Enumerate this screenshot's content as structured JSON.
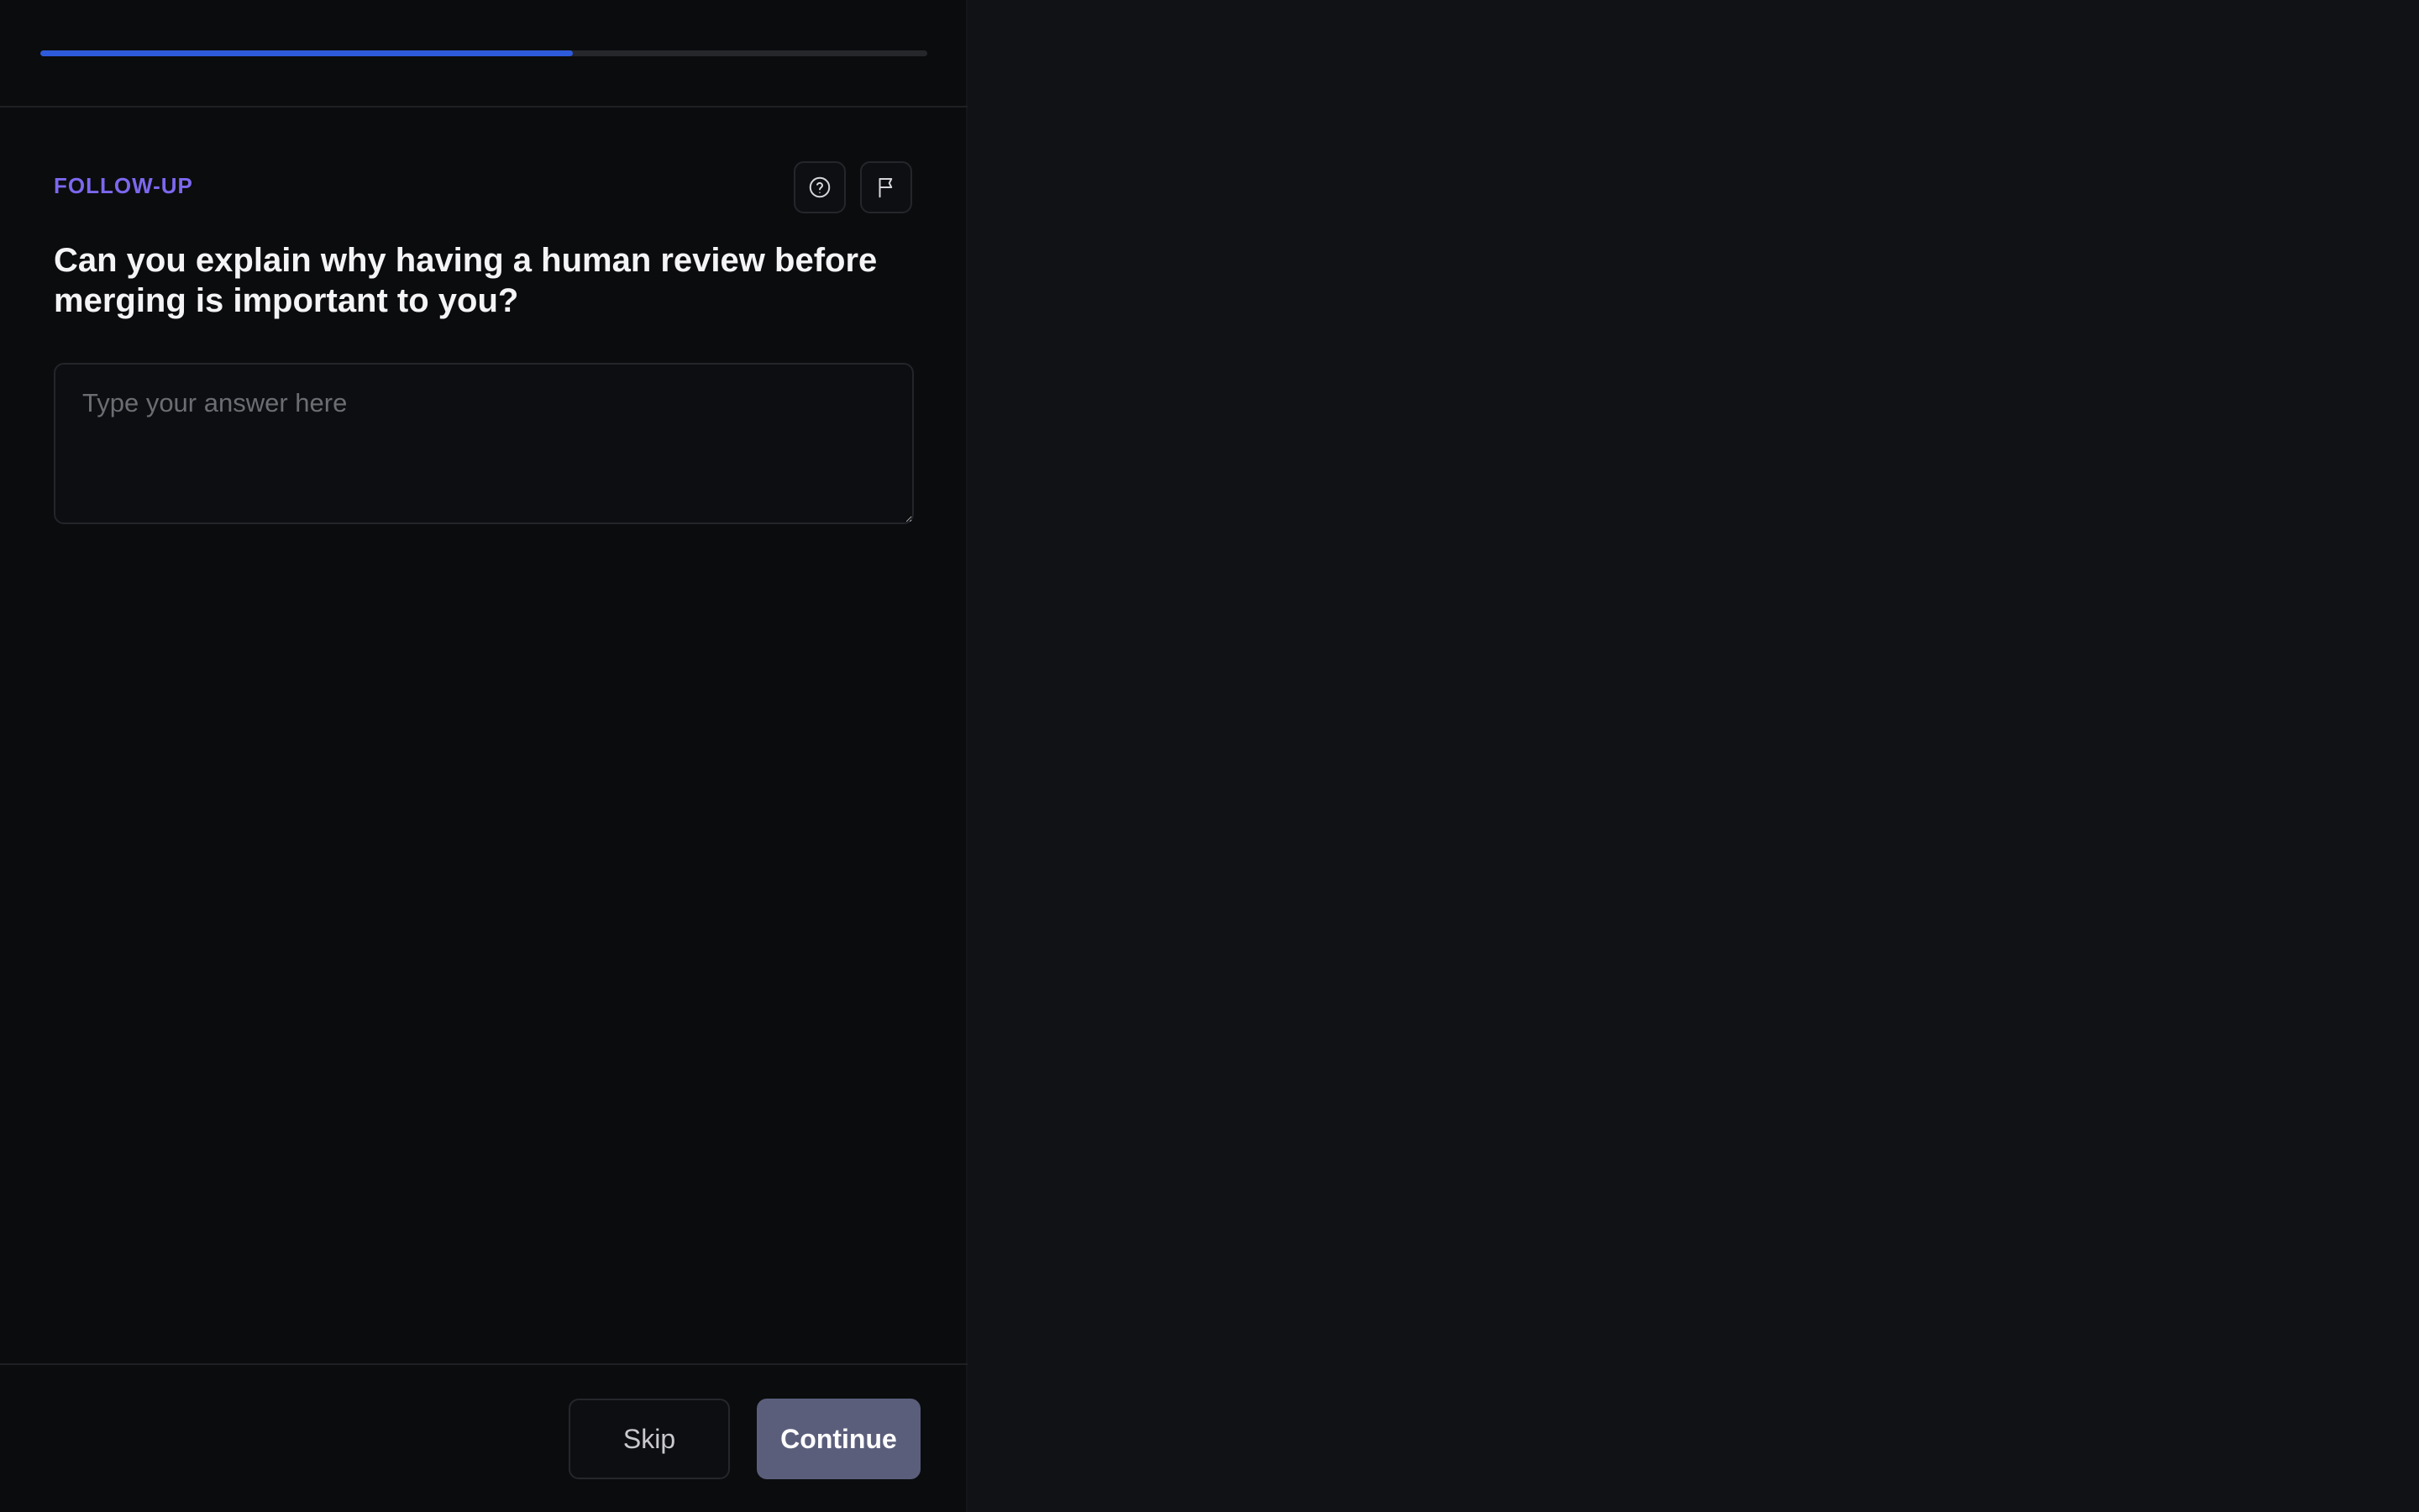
{
  "progress": {
    "fraction": 0.6,
    "track_color": "#26272b",
    "fill_color": "#2e5bdb"
  },
  "question": {
    "eyebrow": "FOLLOW-UP",
    "eyebrow_color": "#7b68ee",
    "text": "Can you explain why having a human review before merging is important to you?"
  },
  "actions": {
    "help_icon": "question-circle",
    "flag_icon": "flag"
  },
  "answer": {
    "value": "",
    "placeholder": "Type your answer here"
  },
  "footer": {
    "skip_label": "Skip",
    "continue_label": "Continue",
    "continue_color": "#5b5e7b"
  }
}
